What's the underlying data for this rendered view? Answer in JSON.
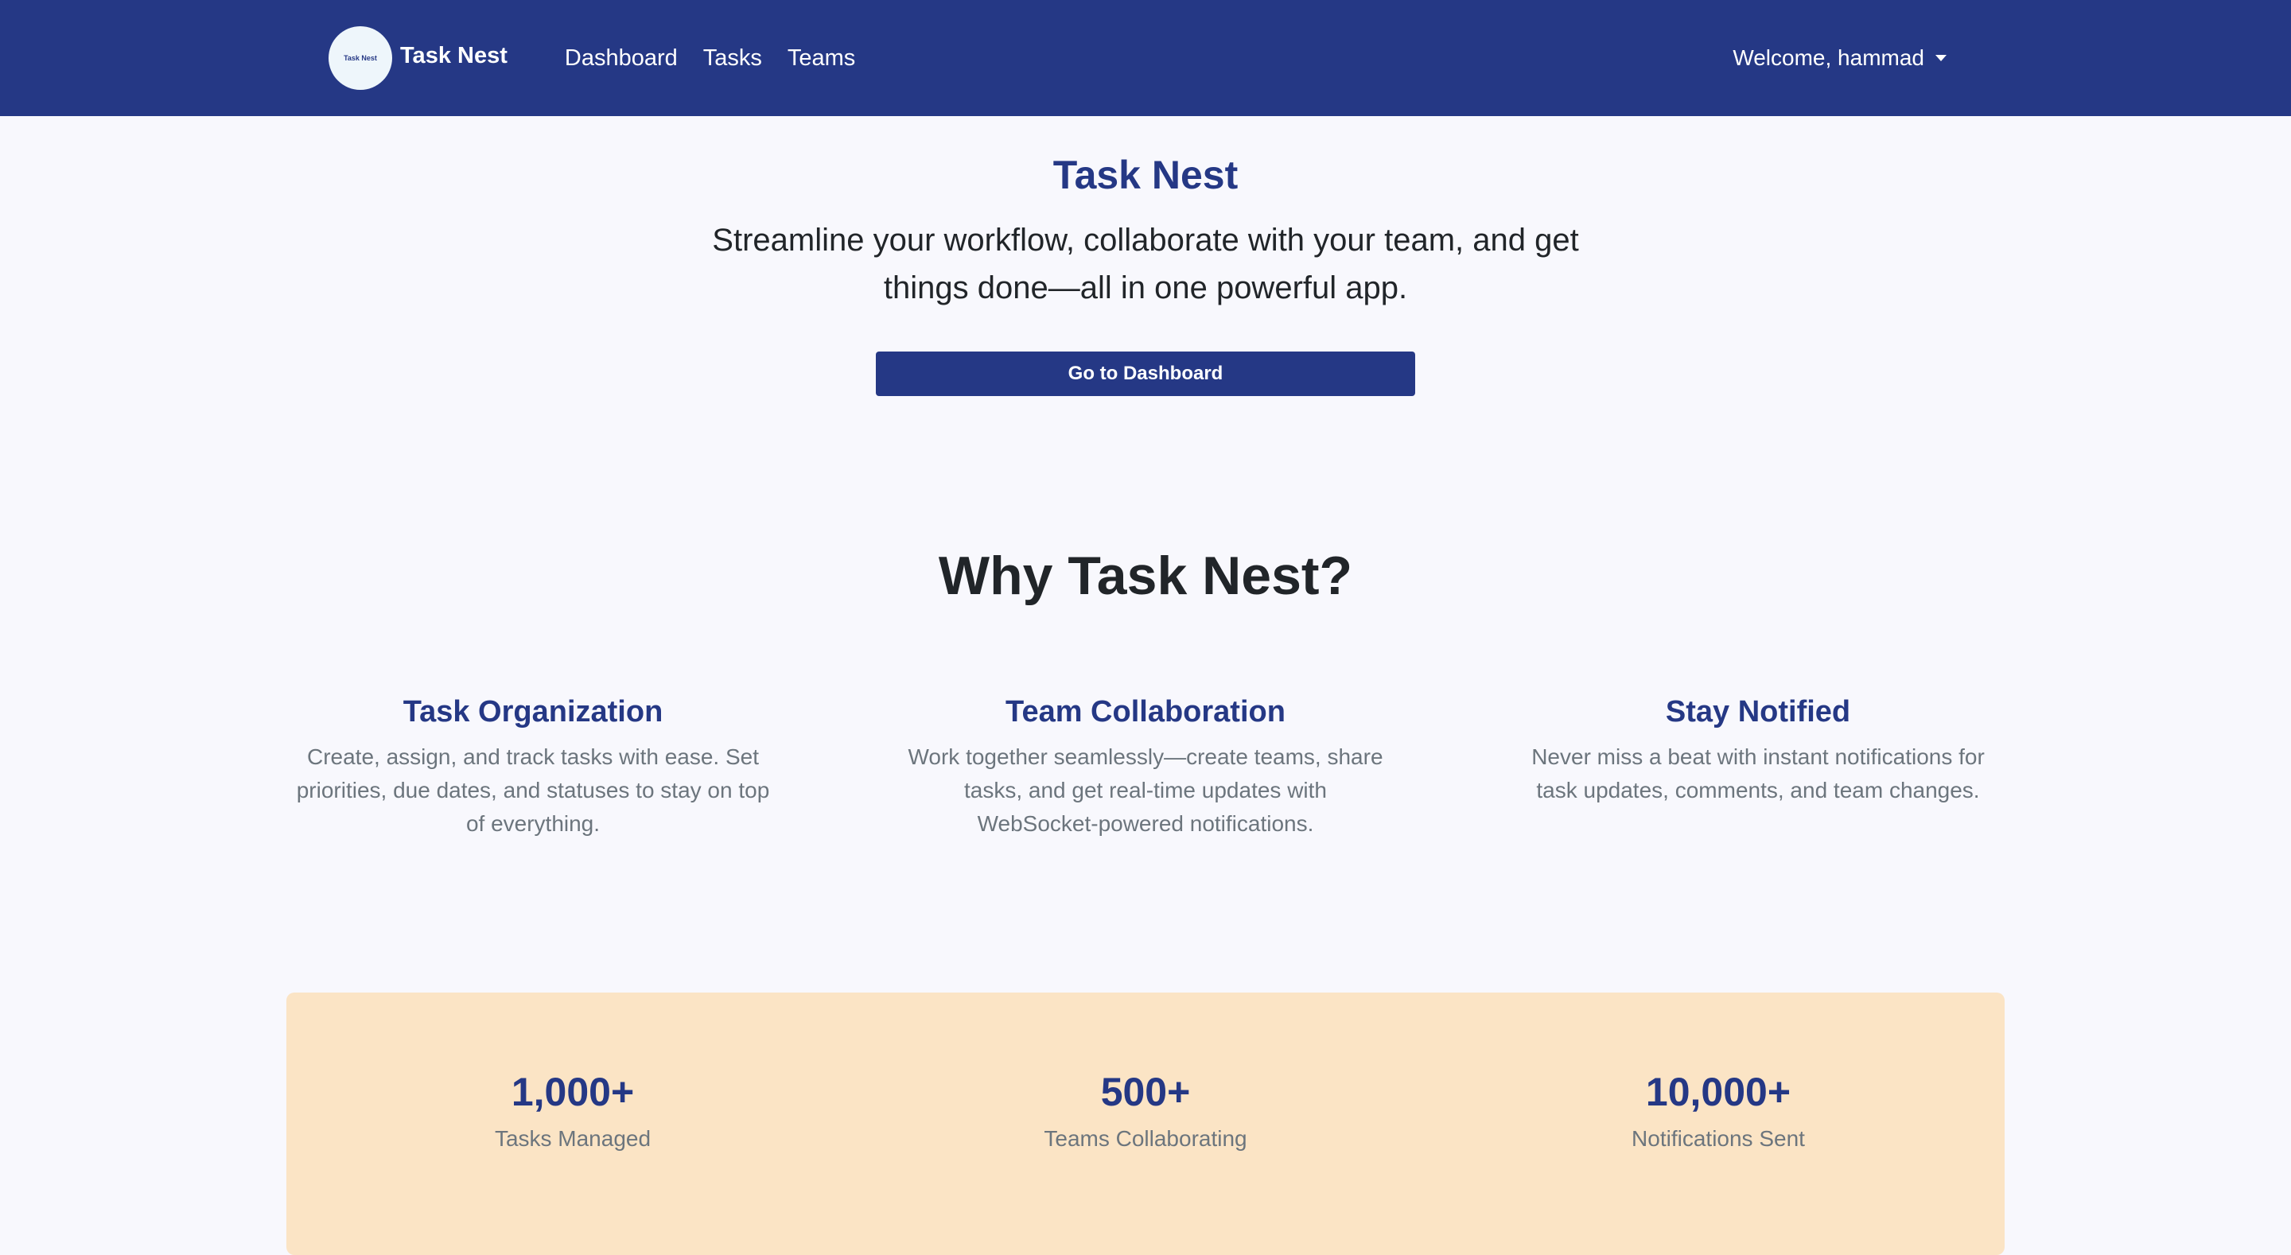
{
  "navbar": {
    "logo_text": "Task Nest",
    "brand": "Task Nest",
    "links": [
      "Dashboard",
      "Tasks",
      "Teams"
    ],
    "user_greeting": "Welcome, hammad"
  },
  "hero": {
    "title": "Task Nest",
    "subtitle": "Streamline your workflow, collaborate with your team, and get things done—all in one powerful app.",
    "cta_label": "Go to Dashboard"
  },
  "why": {
    "title": "Why Task Nest?",
    "features": [
      {
        "title": "Task Organization",
        "description": "Create, assign, and track tasks with ease. Set priorities, due dates, and statuses to stay on top of everything."
      },
      {
        "title": "Team Collaboration",
        "description": "Work together seamlessly—create teams, share tasks, and get real-time updates with WebSocket-powered notifications."
      },
      {
        "title": "Stay Notified",
        "description": "Never miss a beat with instant notifications for task updates, comments, and team changes."
      }
    ]
  },
  "stats": [
    {
      "value": "1,000+",
      "label": "Tasks Managed"
    },
    {
      "value": "500+",
      "label": "Teams Collaborating"
    },
    {
      "value": "10,000+",
      "label": "Notifications Sent"
    }
  ],
  "colors": {
    "primary": "#253885",
    "background": "#f8f8fd",
    "stats_background": "#fbe4c5",
    "muted_text": "#6c757d"
  }
}
